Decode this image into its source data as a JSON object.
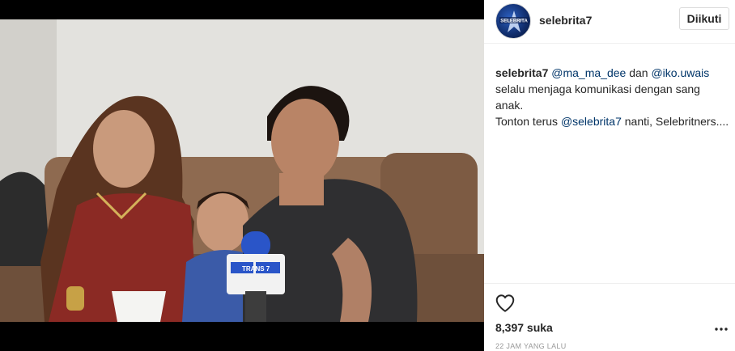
{
  "post": {
    "username": "selebrita7",
    "follow_label": "Diikuti",
    "caption": {
      "user": "selebrita7",
      "mention_1": "@ma_ma_dee",
      "connector": " dan ",
      "mention_2": "@iko.uwais",
      "line_2": "selalu menjaga komunikasi dengan sang anak.",
      "line_3_prefix": "Tonton terus ",
      "mention_3": "@selebrita7",
      "line_3_suffix": " nanti, Selebritners...."
    },
    "likes": "8,397 suka",
    "timestamp": "22 JAM YANG LALU"
  },
  "media": {
    "microphone_brand": "TRANS 7",
    "avatar_brand": "SELEBRITA"
  },
  "icons": {
    "like": "heart-outline-icon",
    "more": "ellipsis-icon"
  },
  "colors": {
    "mention": "#003569",
    "border": "#dbdbdb",
    "muted": "#999999",
    "text": "#262626"
  }
}
